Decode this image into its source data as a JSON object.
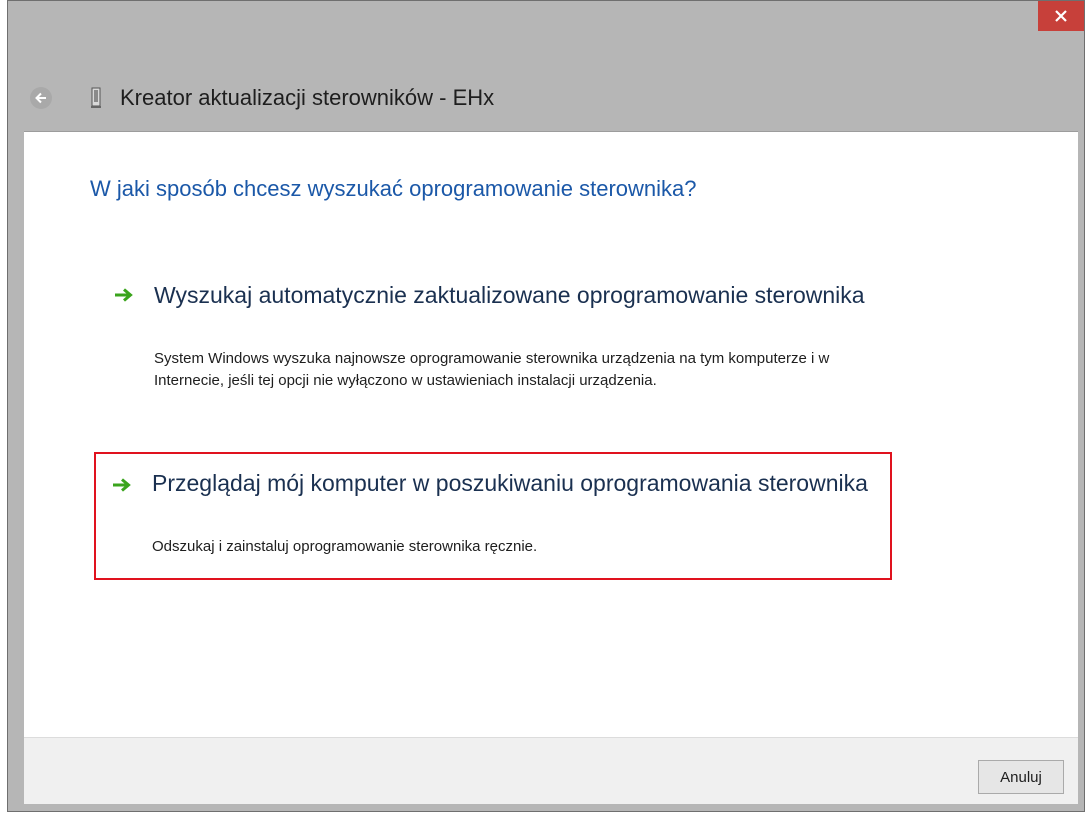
{
  "window": {
    "close_icon": "close-icon",
    "title": "Kreator aktualizacji sterowników - EHx"
  },
  "main": {
    "question": "W jaki sposób chcesz wyszukać oprogramowanie sterownika?",
    "options": [
      {
        "title": "Wyszukaj automatycznie zaktualizowane oprogramowanie sterownika",
        "description": "System Windows wyszuka najnowsze oprogramowanie sterownika urządzenia na tym komputerze i w Internecie, jeśli tej opcji nie wyłączono w ustawieniach instalacji urządzenia."
      },
      {
        "title": "Przeglądaj mój komputer w poszukiwaniu oprogramowania sterownika",
        "description": "Odszukaj i zainstaluj oprogramowanie sterownika ręcznie."
      }
    ]
  },
  "footer": {
    "cancel_label": "Anuluj"
  },
  "colors": {
    "accent": "#1b58a8",
    "close": "#c7403a",
    "highlight": "#e0121e",
    "arrow": "#3aa41c"
  }
}
